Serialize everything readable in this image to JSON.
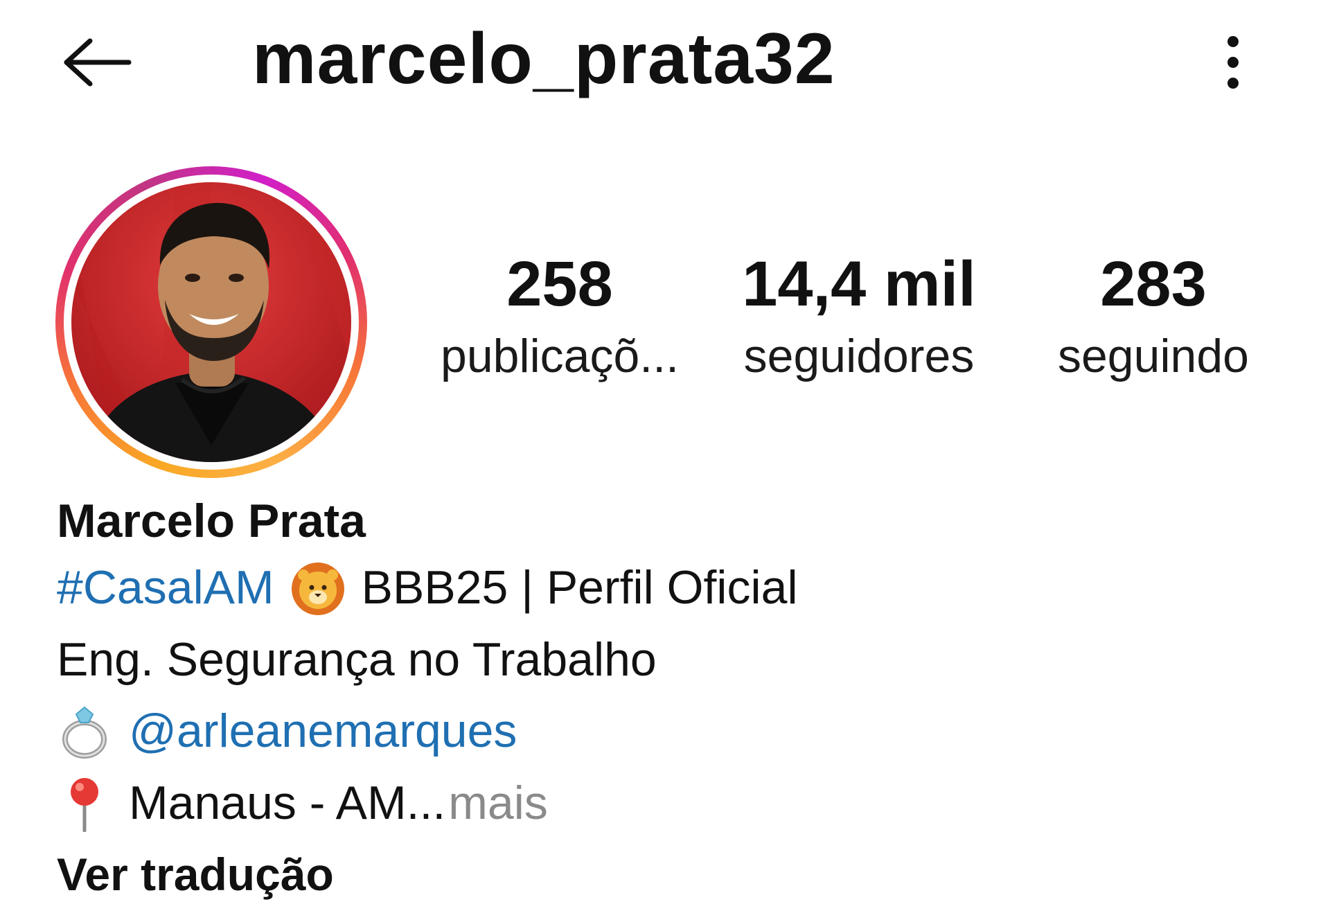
{
  "header": {
    "username": "marcelo_prata32",
    "back_icon": "back-arrow-icon",
    "more_icon": "more-vertical-icon"
  },
  "stats": {
    "posts_count": "258",
    "posts_label": "publicaçõ...",
    "followers_count": "14,4 mil",
    "followers_label": "seguidores",
    "following_count": "283",
    "following_label": "seguindo"
  },
  "profile": {
    "display_name": "Marcelo Prata",
    "bio": {
      "hashtag": "#CasalAM",
      "line1_text": "BBB25 | Perfil Oficial",
      "line2_text": "Eng. Segurança no Trabalho",
      "mention": "@arleanemarques",
      "location_text": "Manaus - AM...",
      "more_label": "mais"
    },
    "translate_label": "Ver tradução"
  },
  "colors": {
    "link": "#1f6fb2",
    "muted": "#8a8a8a",
    "story_ring": [
      "#f9a825",
      "#f77737",
      "#e1306c",
      "#c13584"
    ]
  }
}
